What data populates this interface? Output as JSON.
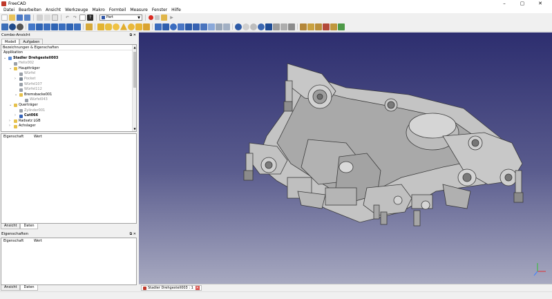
{
  "app": {
    "title": "FreeCAD"
  },
  "window_controls": {
    "minimize": "–",
    "maximize": "▢",
    "close": "✕"
  },
  "menu": [
    "Datei",
    "Bearbeiten",
    "Ansicht",
    "Werkzeuge",
    "Makro",
    "Formteil",
    "Measure",
    "Fenster",
    "Hilfe"
  ],
  "toolbar": {
    "workbench": "Part"
  },
  "combo_view": {
    "title": "Combo-Ansicht",
    "tabs": [
      "Modell",
      "Aufgaben"
    ],
    "tree_header": "Bezeichnungen & Eigenschaften",
    "tree": [
      {
        "label": "Applikation",
        "depth": 0,
        "icon": "none",
        "style": "normal",
        "expander": ""
      },
      {
        "label": "Stadler Drehgestell003",
        "depth": 0,
        "icon": "document",
        "style": "bold",
        "expander": "v"
      },
      {
        "label": "Helix002",
        "depth": 1,
        "icon": "solid",
        "style": "gray",
        "expander": ""
      },
      {
        "label": "Hauptträger",
        "depth": 1,
        "icon": "folder",
        "style": "normal",
        "expander": "v"
      },
      {
        "label": "Würfel",
        "depth": 2,
        "icon": "solid",
        "style": "gray",
        "expander": ""
      },
      {
        "label": "Pocket",
        "depth": 2,
        "icon": "pocket",
        "style": "gray",
        "expander": ">"
      },
      {
        "label": "Würfel107",
        "depth": 2,
        "icon": "solid",
        "style": "gray",
        "expander": ""
      },
      {
        "label": "Würfel112",
        "depth": 2,
        "icon": "solid",
        "style": "gray",
        "expander": ""
      },
      {
        "label": "Bremsbacke001",
        "depth": 2,
        "icon": "folder",
        "style": "normal",
        "expander": "v"
      },
      {
        "label": "Würfel043",
        "depth": 3,
        "icon": "solid",
        "style": "gray",
        "expander": ""
      },
      {
        "label": "Querträger",
        "depth": 1,
        "icon": "folder",
        "style": "normal",
        "expander": "v"
      },
      {
        "label": "Zylinder001",
        "depth": 2,
        "icon": "solid",
        "style": "gray",
        "expander": ""
      },
      {
        "label": "Cut066",
        "depth": 2,
        "icon": "cut",
        "style": "bold",
        "expander": ">"
      },
      {
        "label": "Radsatz LGB",
        "depth": 1,
        "icon": "folder",
        "style": "normal",
        "expander": ">"
      },
      {
        "label": "Achslager",
        "depth": 1,
        "icon": "folder",
        "style": "normal",
        "expander": ">"
      }
    ],
    "prop_columns": [
      "Eigenschaft",
      "Wert"
    ],
    "bottom_tabs": [
      "Ansicht",
      "Daten"
    ]
  },
  "properties_panel": {
    "title": "Eigenschaften",
    "columns": [
      "Eigenschaft",
      "Wert"
    ],
    "bottom_tabs": [
      "Ansicht",
      "Daten"
    ]
  },
  "document_tab": {
    "label": "Stadler Drehgestell003 : 1",
    "close": "✕"
  },
  "colors": {
    "viewport_top": "#2d2e6f",
    "viewport_bottom": "#a7a9c0",
    "model_gray": "#b9b9b9"
  }
}
